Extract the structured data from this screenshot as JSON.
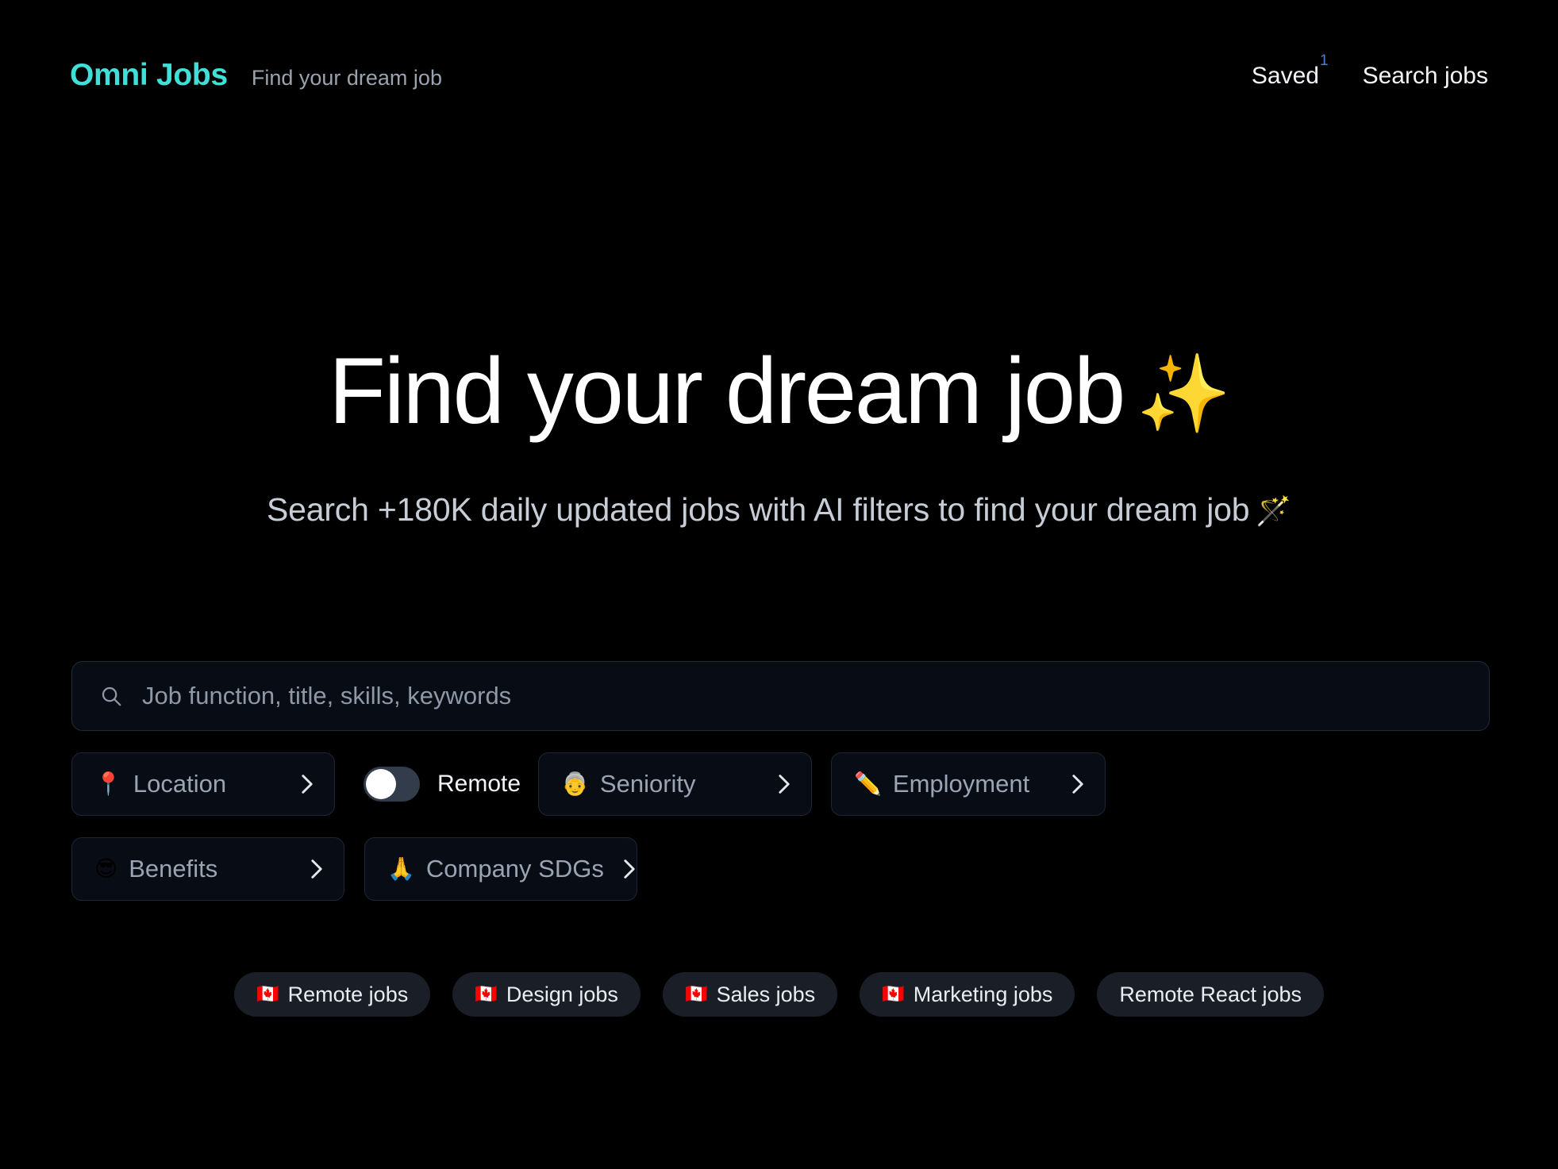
{
  "header": {
    "brand": "Omni Jobs",
    "tagline": "Find your dream job",
    "nav": {
      "saved_label": "Saved",
      "saved_badge": "1",
      "search_jobs_label": "Search jobs"
    }
  },
  "hero": {
    "title": "Find your dream job",
    "title_emoji": "✨",
    "subtitle": "Search +180K daily updated jobs with AI filters to find your dream job",
    "subtitle_emoji": "🪄"
  },
  "search": {
    "placeholder": "Job function, title, skills, keywords",
    "value": "",
    "icon": "search-icon"
  },
  "filters": {
    "row1": [
      {
        "label": "Location",
        "emoji": "📍",
        "icon": "chevron-right-icon"
      },
      {
        "label": "Seniority",
        "emoji": "👵",
        "icon": "chevron-right-icon"
      },
      {
        "label": "Employment",
        "emoji": "✏️",
        "icon": "chevron-right-icon"
      }
    ],
    "row2": [
      {
        "label": "Benefits",
        "emoji": "😎",
        "icon": "chevron-right-icon"
      },
      {
        "label": "Company SDGs",
        "emoji": "🙏",
        "icon": "chevron-right-icon"
      }
    ],
    "remote_toggle": {
      "label": "Remote",
      "state": "off"
    }
  },
  "quick_links": [
    {
      "label": "Remote jobs",
      "emoji": "🇨🇦"
    },
    {
      "label": "Design jobs",
      "emoji": "🇨🇦"
    },
    {
      "label": "Sales jobs",
      "emoji": "🇨🇦"
    },
    {
      "label": "Marketing jobs",
      "emoji": "🇨🇦"
    },
    {
      "label": "Remote React jobs",
      "emoji": ""
    }
  ],
  "colors": {
    "background": "#000000",
    "brand_accent": "#3fe0d8",
    "badge_blue": "#4a7fd4",
    "field_bg": "#080c15",
    "field_border": "#232b39",
    "pill_bg": "#1a1e26",
    "toggle_track": "#333c4b",
    "toggle_knob": "#ffffff",
    "muted_text": "#9aa4b2"
  }
}
